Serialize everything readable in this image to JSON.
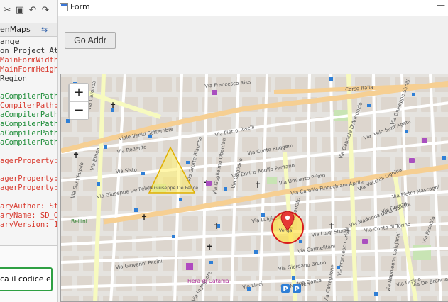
{
  "ide": {
    "tab_label": "enMaps",
    "range_label": "ange",
    "lines": [
      {
        "text": "on Project At",
        "color": "dark"
      },
      {
        "text": "MainFormWidth",
        "color": "red"
      },
      {
        "text": "MainFormHeigh",
        "color": "red"
      },
      {
        "text": "Region",
        "color": "dark"
      },
      {
        "text": "",
        "color": "dark"
      },
      {
        "text": "aCompilerPath",
        "color": "green"
      },
      {
        "text": "CompilerPath:",
        "color": "red"
      },
      {
        "text": "aCompilerPath",
        "color": "green"
      },
      {
        "text": "aCompilerPath",
        "color": "green"
      },
      {
        "text": "aCompilerPath",
        "color": "green"
      },
      {
        "text": "aCompilerPath",
        "color": "green"
      },
      {
        "text": "",
        "color": "dark"
      },
      {
        "text": "agerProperty:",
        "color": "red"
      },
      {
        "text": "",
        "color": "dark"
      },
      {
        "text": "agerProperty:",
        "color": "red"
      },
      {
        "text": "agerProperty:",
        "color": "red"
      },
      {
        "text": "",
        "color": "dark"
      },
      {
        "text": "aryAuthor: St",
        "color": "red"
      },
      {
        "text": "aryName: SD_O",
        "color": "red"
      },
      {
        "text": "aryVersion: 1",
        "color": "red"
      }
    ],
    "input_text": "ca il codice e"
  },
  "form": {
    "title": "Form",
    "minimize_label": "—",
    "go_button_label": "Go Addr"
  },
  "map": {
    "zoom_in": "+",
    "zoom_out": "−",
    "streets": [
      {
        "name": "Corso Italia"
      },
      {
        "name": "Via Francesco Riso"
      },
      {
        "name": "Viale Veniti Settembre"
      },
      {
        "name": "Via Pietro Toselli"
      },
      {
        "name": "Via Guglielmo Oberdan"
      },
      {
        "name": "Via Conte Ruggero"
      },
      {
        "name": "Via Enrico Adolfo Pantano"
      },
      {
        "name": "Via Umberto Primo"
      },
      {
        "name": "Via Camillo Finocchiaro Aprile"
      },
      {
        "name": "Via Vecchia Ognina"
      },
      {
        "name": "Via Pietro Mascagni"
      },
      {
        "name": "Via Conte di Torino"
      },
      {
        "name": "Via Redento"
      },
      {
        "name": "Via Sisto"
      },
      {
        "name": "Via Giuseppe De Felice"
      },
      {
        "name": "Via Carmelitani"
      },
      {
        "name": "Via Giordano Bruno"
      },
      {
        "name": "Via Giovanni Pacini"
      },
      {
        "name": "Via Monserrato"
      },
      {
        "name": "Via Francesco Crispi"
      },
      {
        "name": "Via Napoleone Colajanni"
      },
      {
        "name": "Via Ursino"
      },
      {
        "name": "Via Etnea"
      },
      {
        "name": "Via Caronda"
      },
      {
        "name": "Via Sant'Euplio"
      },
      {
        "name": "Via Asilo Sant'Agata"
      },
      {
        "name": "Via Giuseppe Simili"
      },
      {
        "name": "Via Gabriele D'Annunzio"
      },
      {
        "name": "Via Luigi Capuana"
      },
      {
        "name": "Via Luigi Sturzo"
      },
      {
        "name": "Via Madonna della Salette"
      },
      {
        "name": "Via Grotte Bianche"
      },
      {
        "name": "Via Gagliano"
      },
      {
        "name": "Via Caltagirone"
      },
      {
        "name": "Via Pasubio"
      },
      {
        "name": "Via De Brancia"
      },
      {
        "name": "Via Dante"
      },
      {
        "name": "Via Firenze"
      },
      {
        "name": "Via Madden"
      },
      {
        "name": "Via Ingegnere"
      },
      {
        "name": "Via Lieci"
      }
    ],
    "places": [
      "Bellini",
      "Fiera di Catania"
    ],
    "marker_label": "Verga",
    "triangle_label": "Via Giuseppe De Felice",
    "colors": {
      "land": "#e5e3df",
      "block": "#d9d2c8",
      "major_road": "#f6cf92",
      "secondary_road": "#f7fabf",
      "minor_road": "#ffffff",
      "park": "#c8e4b4",
      "triangle_fill": "#ffee66",
      "triangle_stroke": "#e0b000",
      "circle_fill": "#ffe14a",
      "circle_stroke": "#d81b1b",
      "marker": "#e53935"
    }
  }
}
